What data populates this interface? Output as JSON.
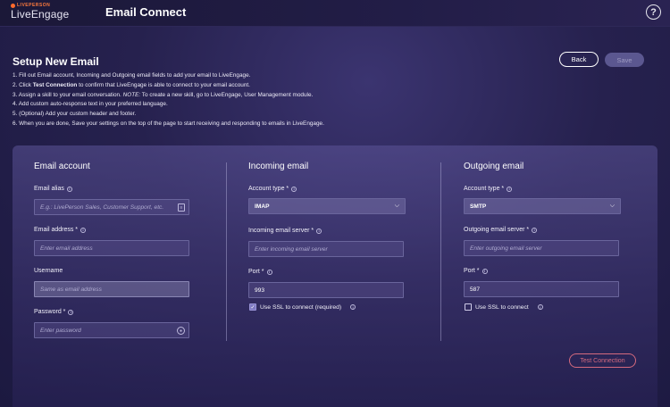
{
  "header": {
    "logo_small": "LIVEPERSON",
    "logo_main": "LiveEngage",
    "app_title": "Email Connect",
    "help_label": "?"
  },
  "page": {
    "title": "Setup New Email",
    "back_label": "Back",
    "save_label": "Save",
    "instructions": [
      {
        "pre": "1. Fill out Email account, Incoming and Outgoing email fields to add your email to LiveEngage.",
        "bold": "",
        "italic": "",
        "post": ""
      },
      {
        "pre": "2. Click ",
        "bold": "Test Connection",
        "italic": "",
        "post": " to confirm that LiveEngage is able to connect to your email account."
      },
      {
        "pre": "3. Assign a skill to your email conversation. ",
        "bold": "",
        "italic": "NOTE:",
        "post": " To create a new skill, go to LiveEngage, User Management module."
      },
      {
        "pre": "4. Add custom auto-response text in your preferred language.",
        "bold": "",
        "italic": "",
        "post": ""
      },
      {
        "pre": "5. (Optional) Add your custom header and footer.",
        "bold": "",
        "italic": "",
        "post": ""
      },
      {
        "pre": "6. When you are done, Save your settings on the top of the page to start receiving and responding to emails in LiveEngage.",
        "bold": "",
        "italic": "",
        "post": ""
      }
    ]
  },
  "email_account": {
    "title": "Email account",
    "alias_label": "Email alias",
    "alias_placeholder": "E.g.: LivePerson Sales, Customer Support, etc.",
    "address_label": "Email address *",
    "address_placeholder": "Enter email address",
    "username_label": "Username",
    "username_placeholder": "Same as email address",
    "password_label": "Password *",
    "password_placeholder": "Enter password"
  },
  "incoming": {
    "title": "Incoming email",
    "account_type_label": "Account type *",
    "account_type_value": "IMAP",
    "server_label": "Incoming email server *",
    "server_placeholder": "Enter incoming email server",
    "port_label": "Port *",
    "port_value": "993",
    "ssl_label": "Use SSL to connect (required)",
    "ssl_checked": true
  },
  "outgoing": {
    "title": "Outgoing email",
    "account_type_label": "Account type *",
    "account_type_value": "SMTP",
    "server_label": "Outgoing email server *",
    "server_placeholder": "Enter outgoing email server",
    "port_label": "Port *",
    "port_value": "587",
    "ssl_label": "Use SSL to connect",
    "ssl_checked": false
  },
  "test_connection_label": "Test Connection",
  "icons": {
    "help": "question-circle-icon",
    "info": "info-circle-icon",
    "chevron": "chevron-down-icon",
    "contact-card": "contact-card-icon",
    "eye": "eye-icon",
    "check": "checkmark-icon"
  },
  "colors": {
    "background": "#26214e",
    "panel": "#4a4384",
    "test_connection": "#d46a7e",
    "checkbox_checked": "#7e79c2"
  }
}
